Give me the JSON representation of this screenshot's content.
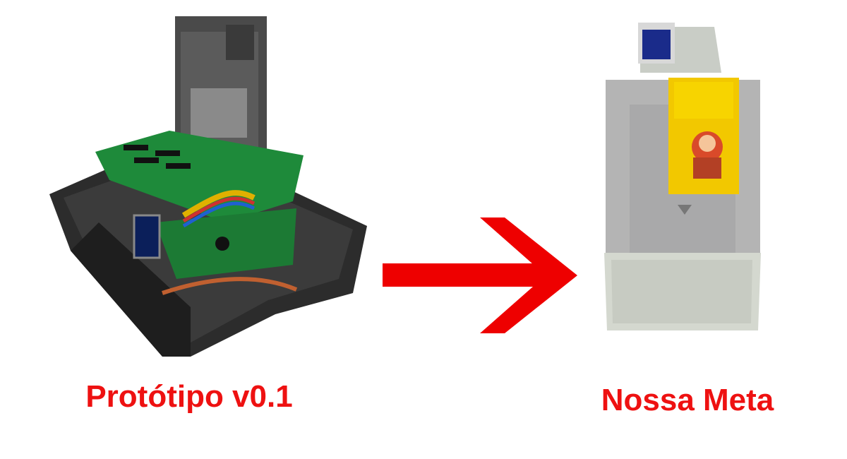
{
  "left": {
    "caption": "Protótipo v0.1"
  },
  "right": {
    "caption": "Nossa Meta"
  },
  "colors": {
    "caption": "#ee1111",
    "arrow": "#ee0000"
  },
  "icons": {
    "transition": "arrow-right-icon"
  }
}
